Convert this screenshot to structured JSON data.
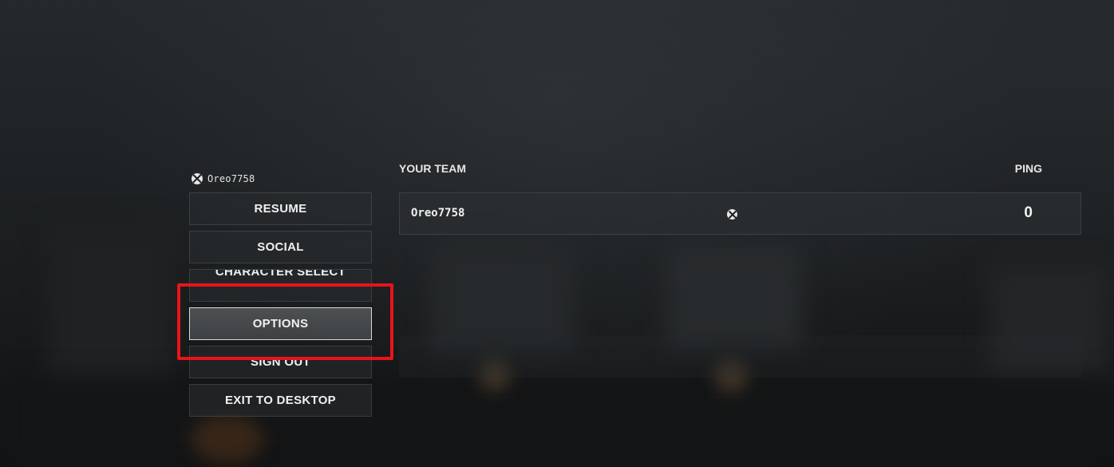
{
  "user": {
    "gamertag": "Oreo7758",
    "platform_icon": "xbox-icon"
  },
  "menu": {
    "items": [
      {
        "label": "RESUME"
      },
      {
        "label": "SOCIAL"
      },
      {
        "label": "CHARACTER SELECT"
      },
      {
        "label": "OPTIONS",
        "selected": true
      },
      {
        "label": "SIGN OUT"
      },
      {
        "label": "EXIT TO DESKTOP"
      }
    ],
    "highlight_color": "#e8141a"
  },
  "team": {
    "title": "YOUR TEAM",
    "ping_header": "PING",
    "players": [
      {
        "name": "Oreo7758",
        "platform_icon": "xbox-icon",
        "ping": "0"
      }
    ]
  }
}
